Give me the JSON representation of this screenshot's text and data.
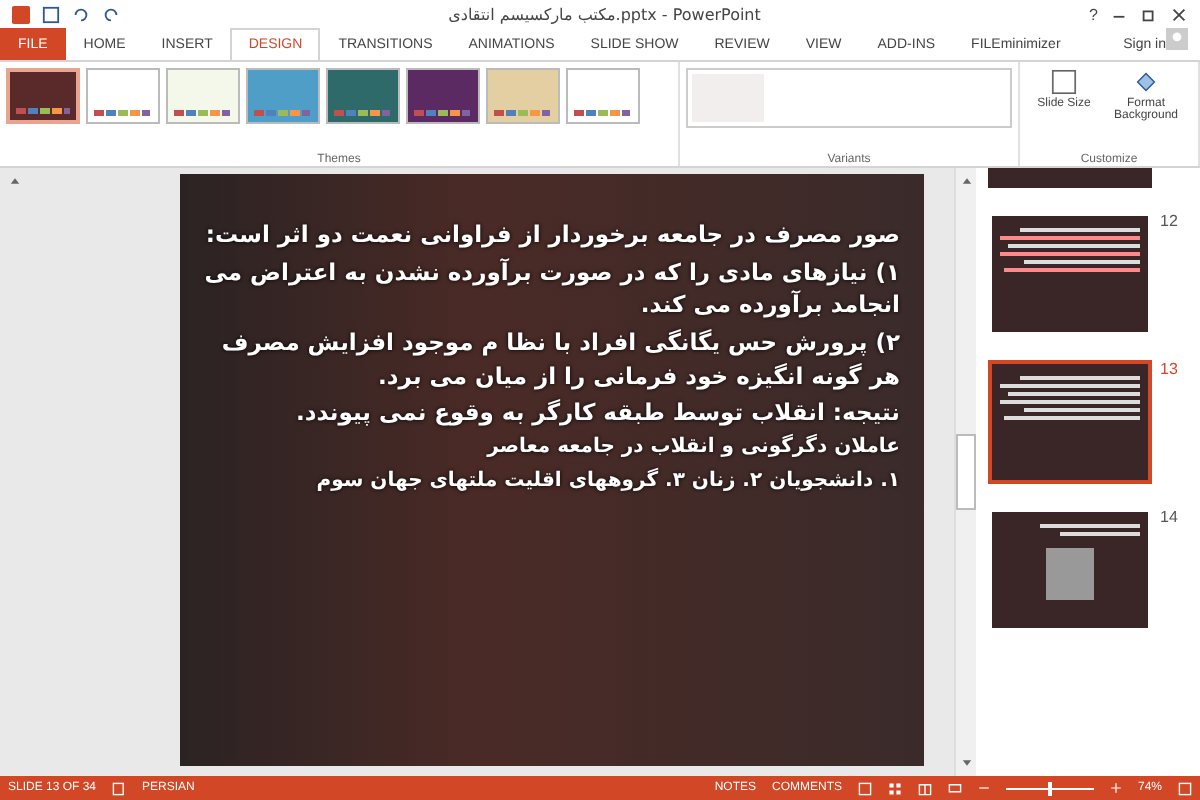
{
  "window": {
    "title": "مکتب مارکسیسم انتقادی.pptx - PowerPoint",
    "sign_in": "Sign in",
    "help": "?"
  },
  "tabs": [
    {
      "label": "FILE",
      "kind": "file",
      "selected": false
    },
    {
      "label": "HOME",
      "kind": "tab",
      "selected": false
    },
    {
      "label": "INSERT",
      "kind": "tab",
      "selected": false
    },
    {
      "label": "DESIGN",
      "kind": "tab",
      "selected": true
    },
    {
      "label": "TRANSITIONS",
      "kind": "tab",
      "selected": false
    },
    {
      "label": "ANIMATIONS",
      "kind": "tab",
      "selected": false
    },
    {
      "label": "SLIDE SHOW",
      "kind": "tab",
      "selected": false
    },
    {
      "label": "REVIEW",
      "kind": "tab",
      "selected": false
    },
    {
      "label": "VIEW",
      "kind": "tab",
      "selected": false
    },
    {
      "label": "ADD-INS",
      "kind": "tab",
      "selected": false
    },
    {
      "label": "FILEminimizer",
      "kind": "tab",
      "selected": false
    }
  ],
  "ribbon": {
    "themes_label": "Themes",
    "variants_label": "Variants",
    "customize_label": "Customize",
    "themes": [
      {
        "color": "#5a2a2a",
        "selected": true
      },
      {
        "color": "#ffffff",
        "selected": false
      },
      {
        "color": "#f4f8ea",
        "selected": false
      },
      {
        "color": "#4f9ec8",
        "selected": false
      },
      {
        "color": "#2f6a6a",
        "selected": false
      },
      {
        "color": "#5c2a63",
        "selected": false
      },
      {
        "color": "#e3cfa2",
        "selected": false
      },
      {
        "color": "#ffffff",
        "selected": false
      }
    ],
    "buttons": [
      {
        "label": "Slide Size",
        "kind": "size"
      },
      {
        "label": "Format Background",
        "kind": "background"
      }
    ]
  },
  "slide": {
    "paragraphs": [
      {
        "text": "صور مصرف در جامعه برخوردار از فراوانی نعمت دو اثر است:",
        "kind": "main"
      },
      {
        "text": "۱) نیازهای مادی را که  در صورت برآورده نشدن به اعتراض می انجامد برآورده می کند.",
        "kind": "main"
      },
      {
        "text": "۲) پرورش حس یگانگی افراد با نظا م موجود افزایش مصرف هر گونه انگیزه خود فرمانی را از میان می برد.",
        "kind": "main"
      },
      {
        "text": "نتیجه: انقلاب  توسط طبقه کارگر به وقوع نمی پیوندد.",
        "kind": "main"
      },
      {
        "text": "عاملان دگرگونی و انقلاب در جامعه معاصر",
        "kind": "small"
      },
      {
        "text": "۱. دانشجویان  ۲. زنان ۳. گروههای اقلیت ملتهای جهان سوم",
        "kind": "small"
      }
    ]
  },
  "thumbnails": [
    {
      "number": "12",
      "selected": false,
      "kind": "bullets"
    },
    {
      "number": "13",
      "selected": true,
      "kind": "text"
    },
    {
      "number": "14",
      "selected": false,
      "kind": "photo"
    }
  ],
  "status_bar": {
    "slide": "SLIDE 13 OF 34",
    "language": "PERSIAN",
    "notes": "NOTES",
    "comments": "COMMENTS",
    "zoom": "74%",
    "zoom_slider": {
      "level": 0.5
    }
  }
}
